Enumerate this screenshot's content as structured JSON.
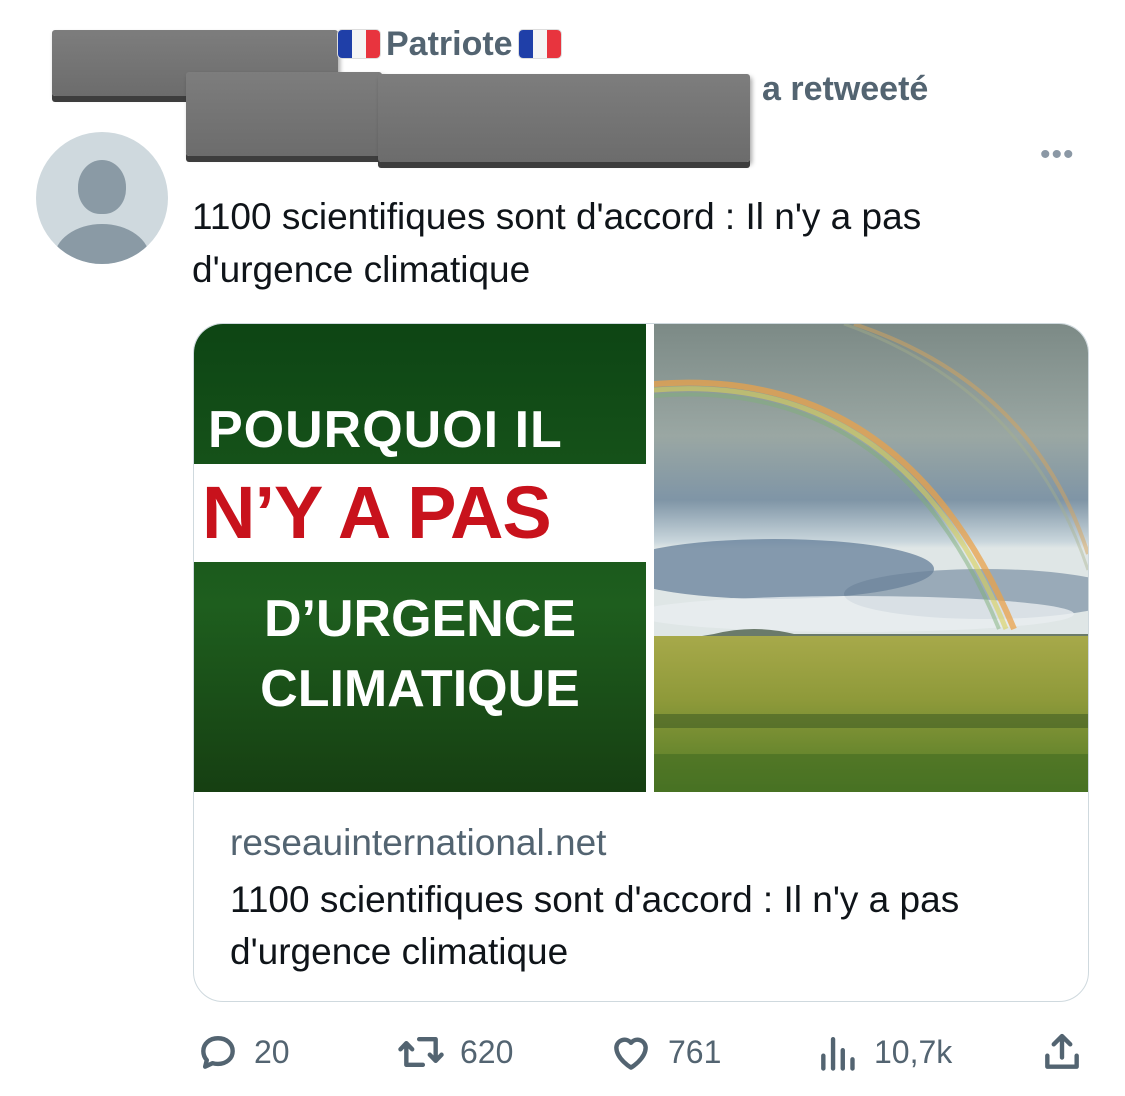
{
  "retweet": {
    "account_name": "Patriote",
    "label": "a retweeté"
  },
  "tweet": {
    "text": "1100 scientifiques sont d'accord : Il n'y a pas d'urgence climatique",
    "more_glyph": "•••"
  },
  "card": {
    "image_text": {
      "line1": "POURQUOI IL",
      "line2": "N’Y A PAS",
      "line3": "D’URGENCE",
      "line4": "CLIMATIQUE"
    },
    "domain": "reseauinternational.net",
    "title": "1100 scientifiques sont d'accord : Il n'y a pas d'urgence climatique"
  },
  "actions": {
    "replies": "20",
    "retweets": "620",
    "likes": "761",
    "views": "10,7k"
  },
  "icons": [
    "flag-france-icon",
    "more-icon",
    "reply-icon",
    "retweet-icon",
    "like-icon",
    "views-icon",
    "share-icon"
  ]
}
